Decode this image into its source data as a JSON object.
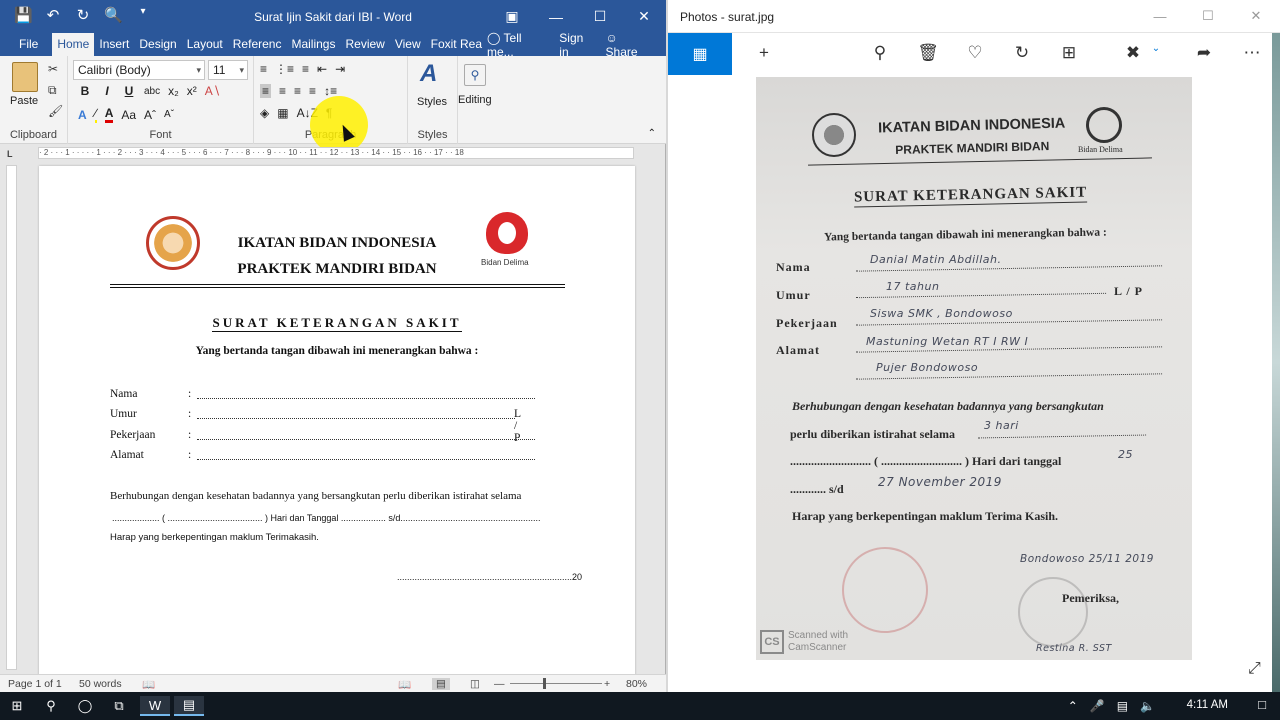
{
  "word": {
    "title": "Surat Ijin Sakit dari IBI - Word",
    "tabs": [
      "Home",
      "Insert",
      "Design",
      "Layout",
      "Referenc",
      "Mailings",
      "Review",
      "View",
      "Foxit Rea"
    ],
    "file_tab": "File",
    "tell_me": "Tell me...",
    "sign_in": "Sign in",
    "share": "Share",
    "ribbon": {
      "paste": "Paste",
      "font_name": "Calibri (Body)",
      "font_size": "11",
      "styles": "Styles",
      "editing": "Editing",
      "groups": [
        "Clipboard",
        "Font",
        "Paragraph",
        "Styles"
      ]
    },
    "ruler_corner": "L",
    "ruler_text": "· 2 · · · 1 · · · · · 1 · · · 2 · · · 3 · · · 4 · · · 5 · · · 6 · · · 7 · · · 8 · · · 9 · · · 10 · · 11 · · 12 · · 13 · · 14 · · 15 · · 16 · · 17 · · 18",
    "doc": {
      "org_line1": "IKATAN BIDAN INDONESIA",
      "org_line2": "PRAKTEK MANDIRI BIDAN",
      "logo2_label": "Bidan Delima",
      "title": "SURAT KETERANGAN SAKIT",
      "subtitle": "Yang bertanda tangan dibawah ini menerangkan bahwa :",
      "fields": [
        {
          "label": "Nama",
          "colon": ":"
        },
        {
          "label": "Umur",
          "colon": ":",
          "suffix": "L / P"
        },
        {
          "label": "Pekerjaan",
          "colon": ":"
        },
        {
          "label": "Alamat",
          "colon": ":"
        }
      ],
      "paragraph": "Berhubungan dengan kesehatan badannya yang bersangkutan perlu diberikan istirahat selama",
      "line2": "................... ( ...................................... ) Hari dan Tanggal .................. s/d........................................................",
      "line3": "Harap yang berkepentingan maklum Terimakasih.",
      "date_line": "......................................................................20"
    },
    "status": {
      "page": "Page 1 of 1",
      "words": "50 words",
      "zoom": "80%"
    }
  },
  "photos": {
    "title": "Photos - surat.jpg",
    "scan": {
      "org_line1": "IKATAN BIDAN INDONESIA",
      "org_line2": "PRAKTEK MANDIRI BIDAN",
      "logo2_label": "Bidan Delima",
      "title": "SURAT KETERANGAN SAKIT",
      "subtitle": "Yang bertanda tangan dibawah ini menerangkan bahwa :",
      "fields": [
        {
          "label": "Nama",
          "value": "Danial Matin Abdillah."
        },
        {
          "label": "Umur",
          "value": "17 tahun",
          "suffix": "L / P"
        },
        {
          "label": "Pekerjaan",
          "value": "Siswa SMK , Bondowoso"
        },
        {
          "label": "Alamat",
          "value": "Mastuning Wetan RT I RW I"
        }
      ],
      "address_line2": "Pujer Bondowoso",
      "para1": "Berhubungan dengan kesehatan badannya yang bersangkutan",
      "para2": "perlu diberikan istirahat selama",
      "duration": "3 hari",
      "line3": "........................... ( ........................... ) Hari dari tanggal",
      "from_date": "25",
      "line4_prefix": "............ s/d",
      "to_date": "27 November 2019",
      "closing": "Harap yang berkepentingan maklum Terima Kasih.",
      "place_date": "Bondowoso 25/11 2019",
      "examiner": "Pemeriksa,",
      "signer": "Restina R. SST",
      "watermark_1": "Scanned with",
      "watermark_2": "CamScanner",
      "watermark_logo": "CS"
    }
  },
  "taskbar": {
    "clock": "4:11 AM"
  }
}
